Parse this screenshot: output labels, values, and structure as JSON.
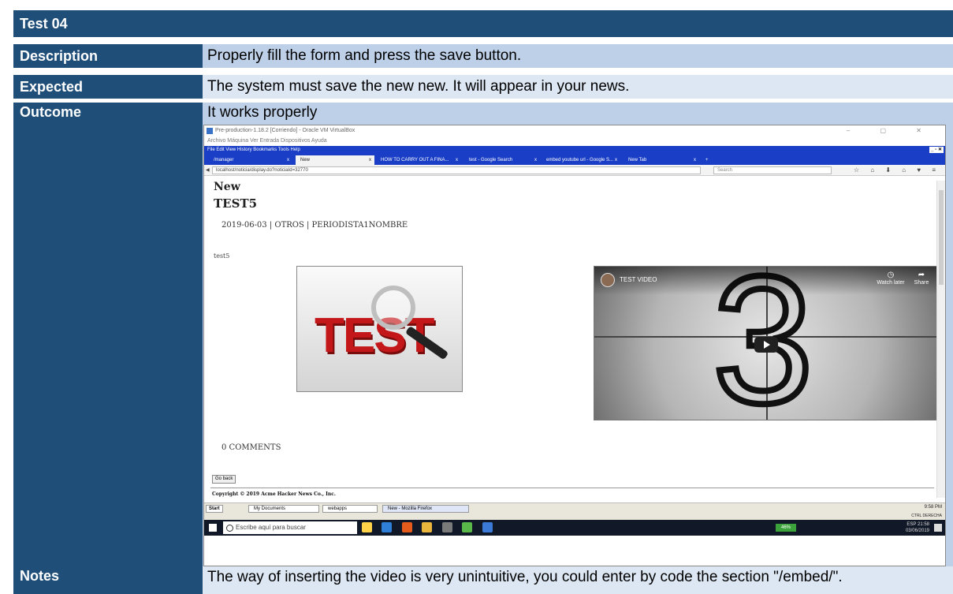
{
  "doc": {
    "title": "Test 04",
    "rows": {
      "description": {
        "label": "Description",
        "value": "Properly fill the form and press the save button."
      },
      "expected": {
        "label": "Expected",
        "value": "The system must save the new new. It will appear in your news."
      },
      "outcome": {
        "label": "Outcome",
        "value": "It works properly"
      },
      "notes": {
        "label": "Notes",
        "value": "The way of inserting the video is very unintuitive, you could enter by code the section \"/embed/\"."
      }
    }
  },
  "screenshot": {
    "vbox_title": "Pre-production-1.18.2 [Corriendo] - Oracle VM VirtualBox",
    "vbox_menu": "Archivo   Máquina   Ver   Entrada   Dispositivos   Ayuda",
    "ff_menu": "File   Edit   View   History   Bookmarks   Tools   Help",
    "tabs": [
      {
        "label": "/manager",
        "x": "x"
      },
      {
        "label": "New",
        "x": "x"
      },
      {
        "label": "HOW TO CARRY OUT A FINA...",
        "x": "x"
      },
      {
        "label": "test - Google Search",
        "x": "x"
      },
      {
        "label": "embed youtube url - Google S...",
        "x": "x"
      },
      {
        "label": "New Tab",
        "x": "x"
      }
    ],
    "url": "localhost/noticia/display.do?noticiaId=32770",
    "search_placeholder": "Search",
    "page": {
      "heading": "New",
      "title": "TEST5",
      "meta": "2019-06-03 | OTROS | PERIODISTA1NOMBRE",
      "body": "test5",
      "image_word": "TEST",
      "video": {
        "title": "TEST VIDEO",
        "watch_later": "Watch later",
        "share": "Share",
        "digit": "3"
      },
      "comments": "0 COMMENTS",
      "go_back": "Go back",
      "copyright": "Copyright © 2019 Acme Hacker News Co., Inc."
    },
    "xp_taskbar": {
      "start": "Start",
      "tasks": [
        "My Documents",
        "webapps",
        "New - Mozilla Firefox"
      ],
      "clock": "9:58 PM",
      "tray": "CTRL DERECHA"
    },
    "win_taskbar": {
      "search": "Escribe aquí para buscar",
      "battery": "46%",
      "lang": "ESP",
      "time": "21:58",
      "date": "03/06/2019"
    }
  }
}
